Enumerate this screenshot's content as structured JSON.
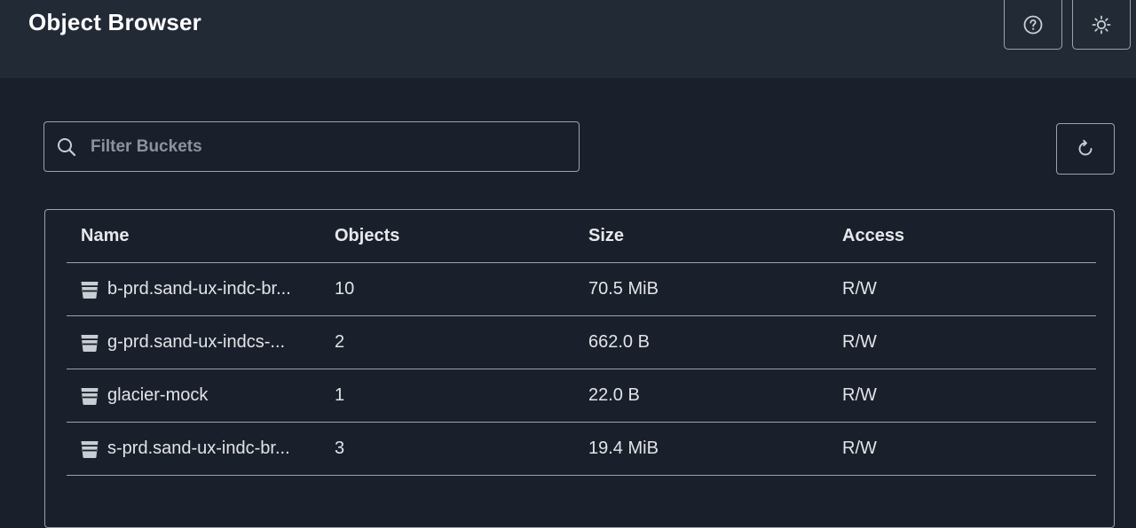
{
  "app": {
    "title": "Object Browser"
  },
  "header": {
    "help_icon": "help-circle-icon",
    "theme_icon": "sun-icon"
  },
  "search": {
    "placeholder": "Filter Buckets",
    "value": ""
  },
  "toolbar": {
    "refresh_icon": "refresh-icon"
  },
  "table": {
    "columns": [
      "Name",
      "Objects",
      "Size",
      "Access"
    ],
    "rows": [
      {
        "name": "b-prd.sand-ux-indc-br...",
        "objects": "10",
        "size": "70.5 MiB",
        "access": "R/W"
      },
      {
        "name": "g-prd.sand-ux-indcs-...",
        "objects": "2",
        "size": "662.0 B",
        "access": "R/W"
      },
      {
        "name": "glacier-mock",
        "objects": "1",
        "size": "22.0 B",
        "access": "R/W"
      },
      {
        "name": "s-prd.sand-ux-indc-br...",
        "objects": "3",
        "size": "19.4 MiB",
        "access": "R/W"
      }
    ],
    "row_icon": "bucket-icon"
  },
  "colors": {
    "background": "#1a202b",
    "header": "#222a36",
    "border": "#9aa3ad",
    "text": "#e6e8eb"
  }
}
